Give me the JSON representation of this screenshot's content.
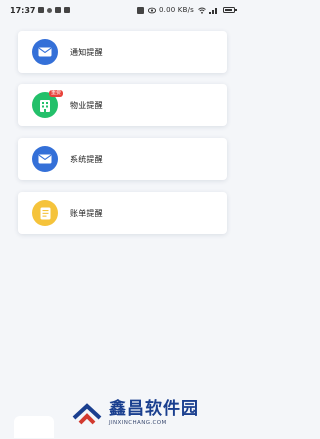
{
  "status_bar": {
    "time": "17:37",
    "right_text": "0.00 KB/s",
    "icons": [
      "notification-icon",
      "message-icon",
      "app-icon",
      "app-icon-2",
      "alarm-icon",
      "eye-icon",
      "wifi-icon",
      "signal-icon",
      "battery-icon"
    ]
  },
  "cards": [
    {
      "label": "通知提醒",
      "icon": "mail-icon",
      "color": "#3470d8"
    },
    {
      "label": "物业提醒",
      "icon": "building-icon",
      "color": "#23c06a",
      "badge": "重要"
    },
    {
      "label": "系统提醒",
      "icon": "mail-icon",
      "color": "#3470d8"
    },
    {
      "label": "账单提醒",
      "icon": "bill-icon",
      "color": "#f5c33b"
    }
  ],
  "watermark": {
    "title": "鑫昌软件园",
    "subtitle": "JINXINCHANG.COM"
  }
}
